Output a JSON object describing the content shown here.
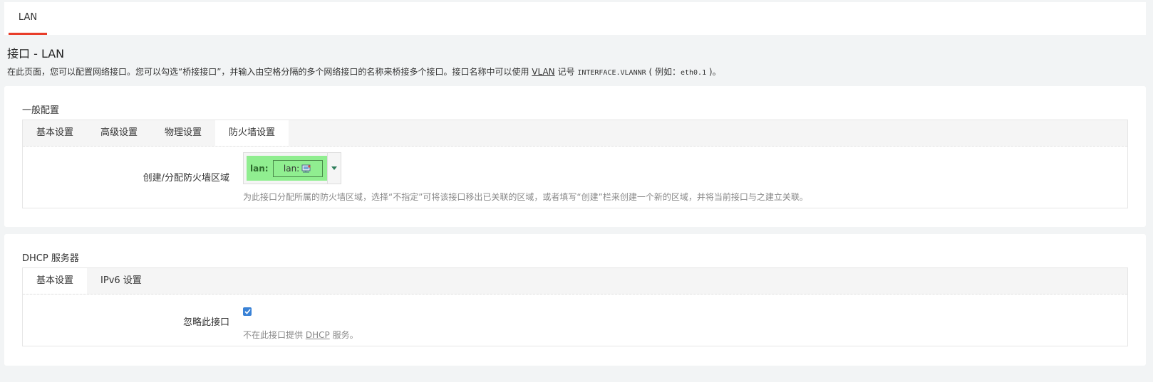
{
  "top_tab": {
    "label": "LAN"
  },
  "page": {
    "title": "接口 - LAN",
    "desc_part1": "在此页面，您可以配置网络接口。您可以勾选“桥接接口”，并输入由空格分隔的多个网络接口的名称来桥接多个接口。接口名称中可以使用",
    "desc_link": "VLAN",
    "desc_part2": "记号",
    "desc_code1": "INTERFACE.VLANNR",
    "desc_part3": "( 例如：",
    "desc_code2": "eth0.1",
    "desc_part4": ")。"
  },
  "general": {
    "title": "一般配置",
    "tabs": [
      {
        "label": "基本设置"
      },
      {
        "label": "高级设置"
      },
      {
        "label": "物理设置"
      },
      {
        "label": "防火墙设置"
      }
    ],
    "firewall_label": "创建/分配防火墙区域",
    "zone_name": "lan:",
    "zone_net": "lan:",
    "firewall_desc": "为此接口分配所属的防火墙区域，选择“不指定”可将该接口移出已关联的区域，或者填写“创建”栏来创建一个新的区域，并将当前接口与之建立关联。",
    "zone_color": "#90ee90"
  },
  "dhcp": {
    "title": "DHCP 服务器",
    "tabs": [
      {
        "label": "基本设置"
      },
      {
        "label": "IPv6 设置"
      }
    ],
    "ignore_label": "忽略此接口",
    "ignore_checked": true,
    "desc_part1": "不在此接口提供",
    "desc_link": "DHCP",
    "desc_part2": "服务。"
  },
  "colors": {
    "accent": "#e83d2a",
    "checkbox": "#3a82d6"
  }
}
